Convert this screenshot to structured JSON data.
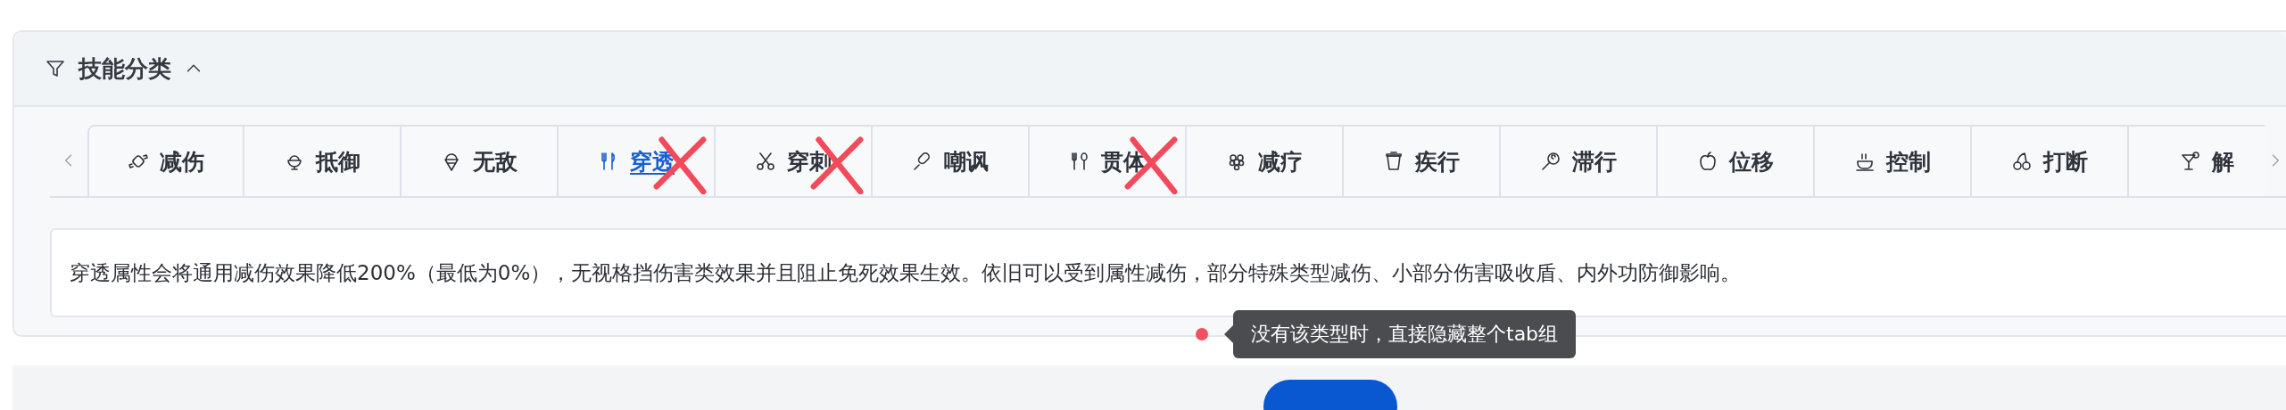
{
  "panel": {
    "title": "技能分类",
    "expanded": true
  },
  "tabs": [
    {
      "label": "减伤",
      "selected": false,
      "crossed_out": false
    },
    {
      "label": "抵御",
      "selected": false,
      "crossed_out": false
    },
    {
      "label": "无敌",
      "selected": false,
      "crossed_out": false
    },
    {
      "label": "穿透",
      "selected": true,
      "crossed_out": true
    },
    {
      "label": "穿刺",
      "selected": false,
      "crossed_out": true
    },
    {
      "label": "嘲讽",
      "selected": false,
      "crossed_out": false
    },
    {
      "label": "贯体",
      "selected": false,
      "crossed_out": true
    },
    {
      "label": "减疗",
      "selected": false,
      "crossed_out": false
    },
    {
      "label": "疾行",
      "selected": false,
      "crossed_out": false
    },
    {
      "label": "滞行",
      "selected": false,
      "crossed_out": false
    },
    {
      "label": "位移",
      "selected": false,
      "crossed_out": false
    },
    {
      "label": "控制",
      "selected": false,
      "crossed_out": false
    },
    {
      "label": "打断",
      "selected": false,
      "crossed_out": false
    },
    {
      "label": "解",
      "selected": false,
      "crossed_out": false
    }
  ],
  "description": "穿透属性会将通用减伤效果降低200%（最低为0%），无视格挡伤害类效果并且阻止免死效果生效。依旧可以受到属性减伤，部分特殊类型减伤、小部分伤害吸收盾、内外功防御影响。",
  "annotation": {
    "text": "没有该类型时，直接隐藏整个tab组"
  }
}
